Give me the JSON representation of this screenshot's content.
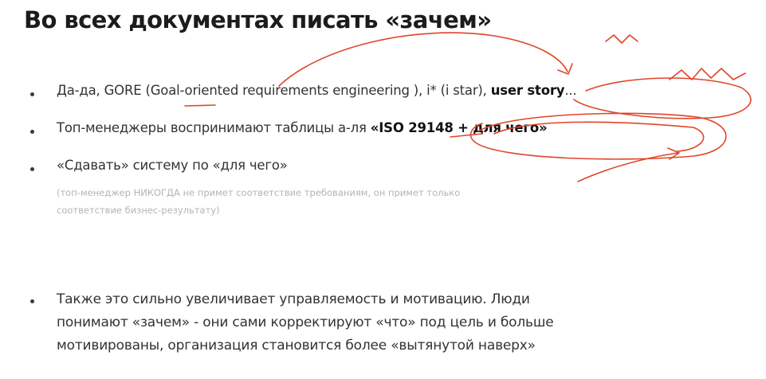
{
  "slide": {
    "title": "Во всех документах писать «зачем»",
    "bullet1": {
      "text": "Да-да, GORE (Goal-oriented requirements engineering ), i* (i star), ",
      "bold": "user story",
      "tail": "..."
    },
    "bullet2": {
      "text": "Топ-менеджеры воспринимают таблицы а-ля ",
      "bold": "«ISO 29148 + для чего»"
    },
    "bullet3": {
      "text": "«Сдавать» систему по «для чего»",
      "note_line1": "(топ-менеджер НИКОГДА не примет соответствие требованиям, он примет только",
      "note_line2": "соответствие бизнес-результату)"
    },
    "bullet4": {
      "line1": "Также это сильно увеличивает управляемость и мотивацию. Люди",
      "line2": "понимают «зачем» - они сами корректируют «что» под цель и больше",
      "line3": "мотивированы, организация становится более «вытянутой наверх»"
    }
  },
  "colors": {
    "annotation": "#e0452a",
    "text": "#333333",
    "note": "#b4b4b4"
  }
}
